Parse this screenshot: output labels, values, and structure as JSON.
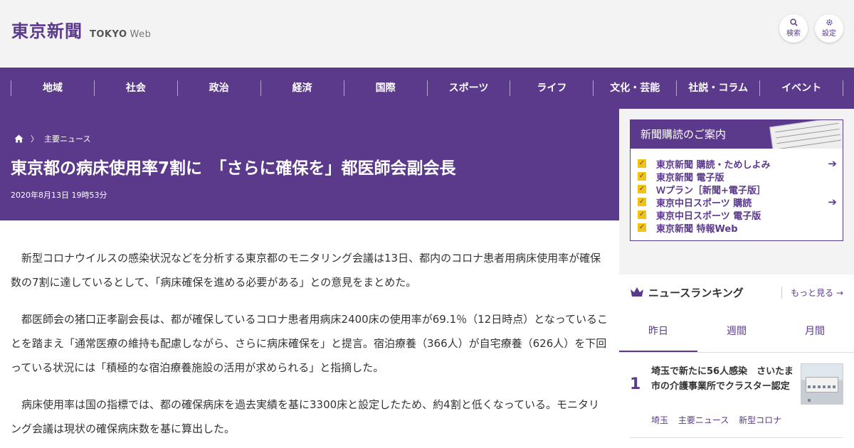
{
  "header": {
    "logo_jp": "東京新聞",
    "logo_en": "TOKYO",
    "logo_web": "Web",
    "search_label": "検索",
    "settings_label": "設定"
  },
  "nav": {
    "items": [
      "地域",
      "社会",
      "政治",
      "経済",
      "国際",
      "スポーツ",
      "ライフ",
      "文化・芸能",
      "社説・コラム",
      "イベント"
    ]
  },
  "article": {
    "breadcrumb": "主要ニュース",
    "title": "東京都の病床使用率7割に　「さらに確保を」都医師会副会長",
    "date": "2020年8月13日 19時53分",
    "paragraphs": [
      "新型コロナウイルスの感染状況などを分析する東京都のモニタリング会議は13日、都内のコロナ患者用病床使用率が確保数の7割に達しているとして、「病床確保を進める必要がある」との意見をまとめた。",
      "都医師会の猪口正孝副会長は、都が確保しているコロナ患者用病床2400床の使用率が69.1％（12日時点）となっていることを踏まえ「通常医療の維持も配慮しながら、さらに病床確保を」と提言。宿泊療養（366人）が自宅療養（626人）を下回っている状況には「積極的な宿泊療養施設の活用が求められる」と指摘した。",
      "病床使用率は国の指標では、都の確保病床を過去実績を基に3300床と設定したため、約4割と低くなっている。モニタリング会議は現状の確保病床数を基に算出した。"
    ]
  },
  "subscription": {
    "heading": "新聞購読のご案内",
    "items": [
      {
        "label": "東京新聞 購読・ためしよみ",
        "arrow": true
      },
      {
        "label": "東京新聞 電子版",
        "arrow": false
      },
      {
        "label": "Ｗプラン［新聞+電子版］",
        "arrow": false
      },
      {
        "label": "東京中日スポーツ 購読",
        "arrow": true
      },
      {
        "label": "東京中日スポーツ 電子版",
        "arrow": false
      },
      {
        "label": "東京新聞 特報Web",
        "arrow": false
      }
    ]
  },
  "ranking": {
    "heading": "ニュースランキング",
    "more_label": "もっと見る",
    "tabs": [
      "昨日",
      "週間",
      "月間"
    ],
    "active_tab": "昨日",
    "items": [
      {
        "rank": "1",
        "title": "埼玉で新たに56人感染　さいたま市の介護事業所でクラスター認定",
        "tags": [
          "埼玉",
          "主要ニュース",
          "新型コロナ"
        ]
      }
    ]
  },
  "colors": {
    "brand": "#5b3a8c",
    "accent_check": "#f1c40f",
    "background": "#f3f3f3"
  }
}
